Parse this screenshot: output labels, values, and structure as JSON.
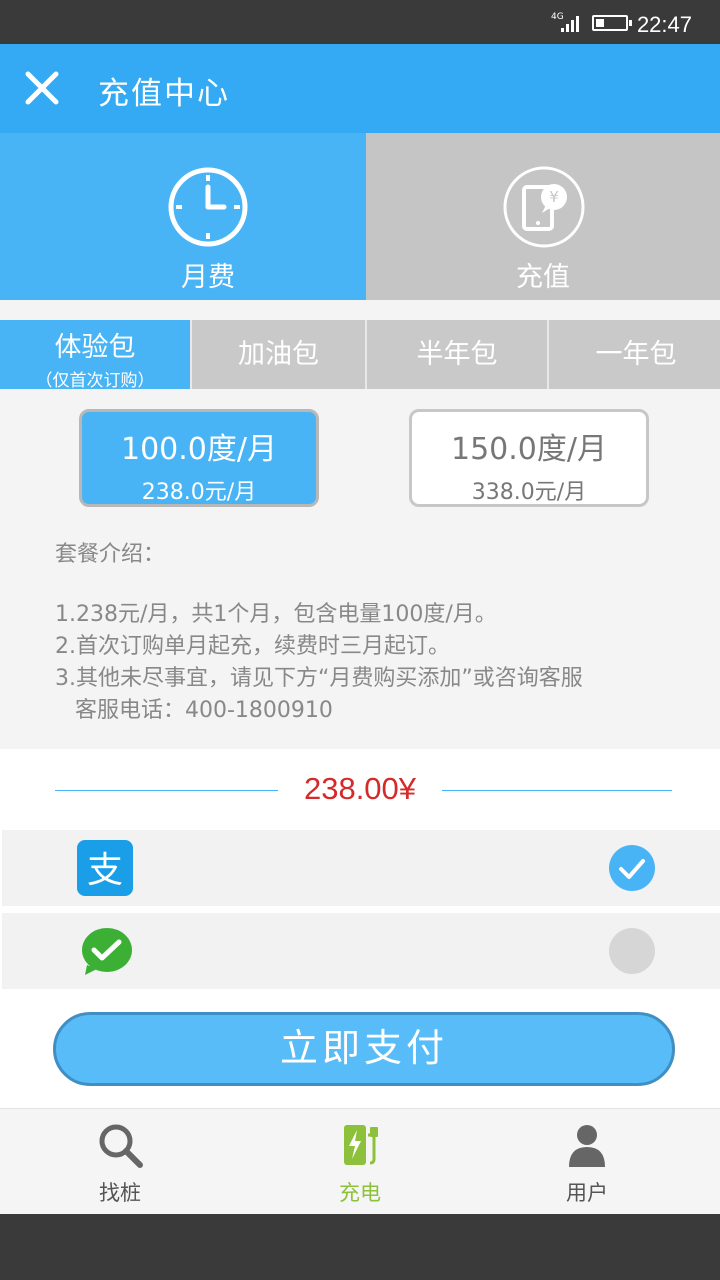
{
  "status_bar": {
    "network": "4G",
    "time": "22:47"
  },
  "header": {
    "title": "充值中心",
    "close_icon": "close-icon"
  },
  "top_tabs": [
    {
      "label": "月费",
      "icon": "clock-icon",
      "active": true
    },
    {
      "label": "充值",
      "icon": "phone-yuan-icon",
      "active": false
    }
  ],
  "package_tabs": [
    {
      "label": "体验包",
      "sub": "（仅首次订购）",
      "active": true
    },
    {
      "label": "加油包",
      "active": false
    },
    {
      "label": "半年包",
      "active": false
    },
    {
      "label": "一年包",
      "active": false
    }
  ],
  "plans": [
    {
      "quantity": "100.0度/月",
      "price": "238.0元/月",
      "selected": true
    },
    {
      "quantity": "150.0度/月",
      "price": "338.0元/月",
      "selected": false
    }
  ],
  "intro": {
    "title": "套餐介绍：",
    "lines": [
      "1.238元/月，共1个月，包含电量100度/月。",
      "2.首次订购单月起充，续费时三月起订。",
      "3.其他未尽事宜，请见下方“月费购买添加”或咨询客服",
      "客服电话：400-1800910"
    ]
  },
  "total": {
    "amount": "238.00¥"
  },
  "payment_methods": [
    {
      "name": "alipay",
      "icon": "alipay-icon",
      "selected": true
    },
    {
      "name": "wechat",
      "icon": "wechat-pay-icon",
      "selected": false
    }
  ],
  "pay_button": {
    "label": "立即支付"
  },
  "bottom_nav": [
    {
      "label": "找桩",
      "icon": "search-icon",
      "active": false
    },
    {
      "label": "充电",
      "icon": "charging-icon",
      "active": true
    },
    {
      "label": "用户",
      "icon": "user-icon",
      "active": false
    }
  ],
  "colors": {
    "header": "#33aaf3",
    "accent": "#49b4f5",
    "price": "#d42a2a",
    "nav_active": "#8dc13c"
  }
}
